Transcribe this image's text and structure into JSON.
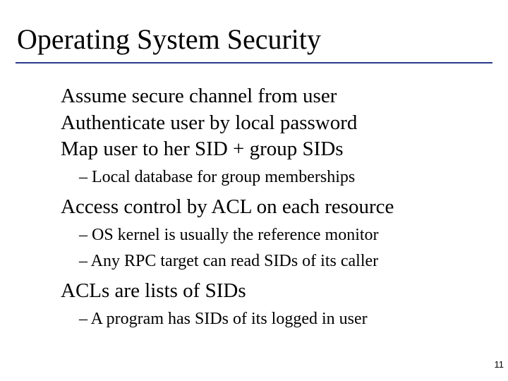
{
  "title": "Operating System Security",
  "bullets": {
    "b1": "Assume secure channel from user",
    "b2": "Authenticate user by local password",
    "b3": "Map user to her SID + group SIDs",
    "b3_sub1": "– Local database for group memberships",
    "b4": "Access control by ACL on each resource",
    "b4_sub1": "– OS kernel is usually the reference monitor",
    "b4_sub2": "– Any RPC target can read SIDs of its caller",
    "b5": "ACLs are lists of SIDs",
    "b5_sub1": "– A program has SIDs of its logged in user"
  },
  "pageNumber": "11"
}
